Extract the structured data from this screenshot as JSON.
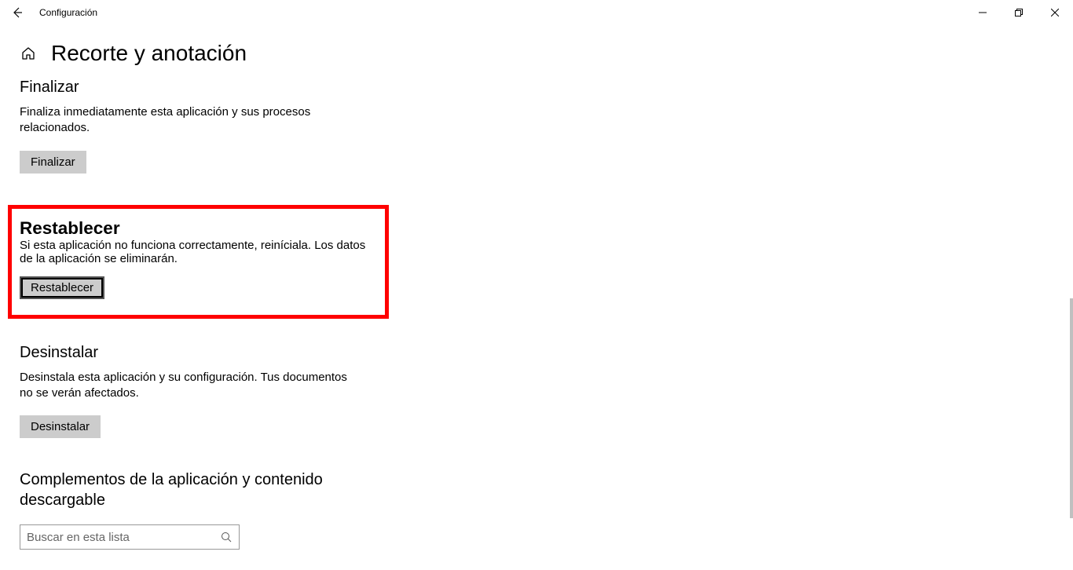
{
  "titlebar": {
    "title": "Configuración"
  },
  "page": {
    "title": "Recorte y anotación"
  },
  "sections": {
    "terminate": {
      "heading": "Finalizar",
      "description": "Finaliza inmediatamente esta aplicación y sus procesos relacionados.",
      "button": "Finalizar"
    },
    "reset": {
      "heading": "Restablecer",
      "description": "Si esta aplicación no funciona correctamente, reiníciala. Los datos de la aplicación se eliminarán.",
      "button": "Restablecer"
    },
    "uninstall": {
      "heading": "Desinstalar",
      "description": "Desinstala esta aplicación y su configuración. Tus documentos no se verán afectados.",
      "button": "Desinstalar"
    },
    "dlc": {
      "heading": "Complementos de la aplicación y contenido descargable",
      "search_placeholder": "Buscar en esta lista"
    }
  }
}
